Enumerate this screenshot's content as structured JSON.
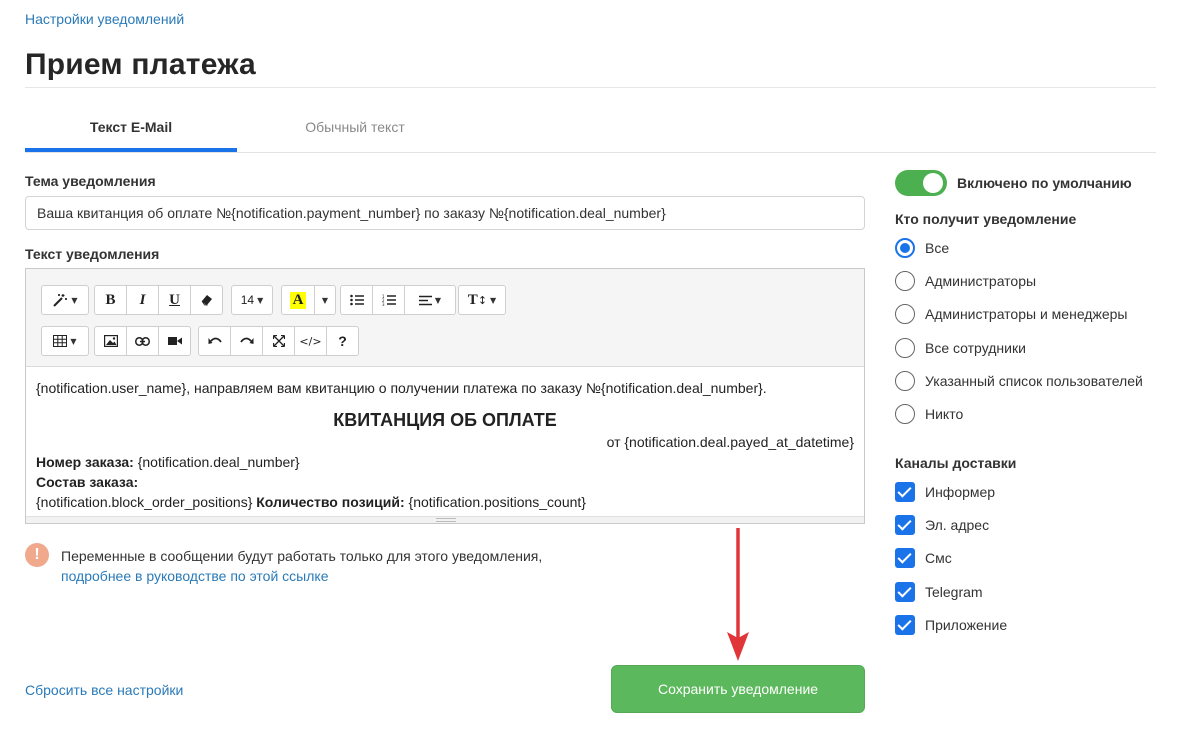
{
  "breadcrumb": "Настройки уведомлений",
  "page_title": "Прием платежа",
  "tabs": [
    {
      "label": "Текст E-Mail",
      "active": true
    },
    {
      "label": "Обычный текст",
      "active": false
    }
  ],
  "subject": {
    "label": "Тема уведомления",
    "value": "Ваша квитанция об оплате №{notification.payment_number} по заказу №{notification.deal_number}"
  },
  "body": {
    "label": "Текст уведомления",
    "toolbar": {
      "font_size": "14",
      "icons": [
        "magic-wand-icon",
        "bold-icon",
        "italic-icon",
        "underline-icon",
        "eraser-icon",
        "font-color-icon",
        "bullet-list-icon",
        "numbered-list-icon",
        "align-icon",
        "text-height-icon",
        "table-icon",
        "image-icon",
        "link-icon",
        "video-icon",
        "undo-icon",
        "redo-icon",
        "fullscreen-icon",
        "code-view-icon",
        "help-icon"
      ]
    },
    "content": {
      "line1": "{notification.user_name}, направляем вам квитанцию о получении платежа по заказу №{notification.deal_number}.",
      "heading": "КВИТАНЦИЯ ОБ ОПЛАТЕ",
      "date_line": "от {notification.deal.payed_at_datetime}",
      "order_label": "Номер заказа:",
      "order_value": " {notification.deal_number}",
      "composition_label": "Состав заказа:",
      "positions_value": "{notification.block_order_positions} ",
      "count_label": "Количество позиций:",
      "count_value": " {notification.positions_count}"
    }
  },
  "notice": {
    "icon": "!",
    "text": "Переменные в сообщении будут работать только для этого уведомления,",
    "link": "подробнее в руководстве по этой ссылке"
  },
  "actions": {
    "reset": "Сбросить все настройки",
    "save": "Сохранить уведомление"
  },
  "sidebar": {
    "toggle_label": "Включено по умолчанию",
    "toggle_on": true,
    "recipients_title": "Кто получит уведомление",
    "recipients": [
      {
        "label": "Все",
        "selected": true
      },
      {
        "label": "Администраторы",
        "selected": false
      },
      {
        "label": "Администраторы и менеджеры",
        "selected": false
      },
      {
        "label": "Все сотрудники",
        "selected": false
      },
      {
        "label": "Указанный список пользователей",
        "selected": false
      },
      {
        "label": "Никто",
        "selected": false
      }
    ],
    "channels_title": "Каналы доставки",
    "channels": [
      {
        "label": "Информер",
        "checked": true
      },
      {
        "label": "Эл. адрес",
        "checked": true
      },
      {
        "label": "Смс",
        "checked": true
      },
      {
        "label": "Telegram",
        "checked": true
      },
      {
        "label": "Приложение",
        "checked": true
      }
    ]
  },
  "colors": {
    "accent": "#1a73e8",
    "link": "#2a7ab8",
    "success": "#5cb85c",
    "toggle": "#4caf50",
    "warning": "#f0a98c",
    "arrow": "#e0363a"
  }
}
